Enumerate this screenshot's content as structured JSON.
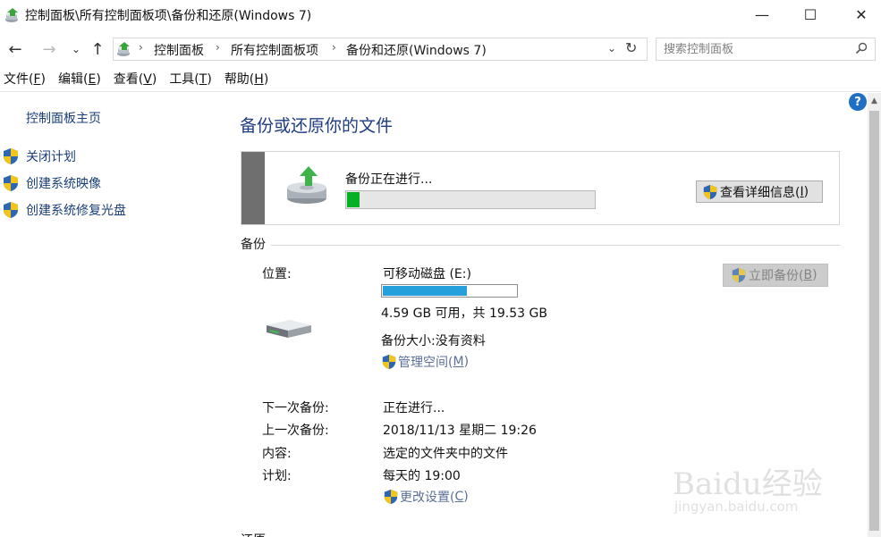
{
  "window": {
    "title": "控制面板\\所有控制面板项\\备份和还原(Windows 7)",
    "min_glyph": "—",
    "max_glyph": "☐",
    "close_glyph": "✕"
  },
  "nav": {
    "back_glyph": "←",
    "forward_glyph": "→",
    "recent_glyph": "⌄",
    "up_glyph": "↑",
    "breadcrumbs": [
      "控制面板",
      "所有控制面板项",
      "备份和还原(Windows 7)"
    ],
    "crumb_sep": "›",
    "dropdown_glyph": "⌄",
    "refresh_glyph": "↻",
    "search_placeholder": "搜索控制面板"
  },
  "menu": {
    "items": [
      {
        "label": "文件(",
        "key": "F",
        "end": ")"
      },
      {
        "label": "编辑(",
        "key": "E",
        "end": ")"
      },
      {
        "label": "查看(",
        "key": "V",
        "end": ")"
      },
      {
        "label": "工具(",
        "key": "T",
        "end": ")"
      },
      {
        "label": "帮助(",
        "key": "H",
        "end": ")"
      }
    ]
  },
  "sidebar": {
    "home": "控制面板主页",
    "tasks": [
      "关闭计划",
      "创建系统映像",
      "创建系统修复光盘"
    ]
  },
  "main": {
    "title": "备份或还原你的文件",
    "progress": {
      "status": "备份正在进行...",
      "fraction": 0.05,
      "details_label": "查看详细信息(",
      "details_key": "I",
      "details_end": ")"
    },
    "section_backup": "备份",
    "location_label": "位置:",
    "location_value": "可移动磁盘 (E:)",
    "disk_used_fraction": 0.62,
    "disk_space": "4.59 GB 可用，共 19.53 GB",
    "backup_size": "备份大小:没有资料",
    "manage_space": "管理空间(",
    "manage_space_key": "M",
    "manage_space_end": ")",
    "backup_now": "立即备份(",
    "backup_now_key": "B",
    "backup_now_end": ")",
    "next_backup_label": "下一次备份:",
    "next_backup_value": "正在进行...",
    "last_backup_label": "上一次备份:",
    "last_backup_value": "2018/11/13 星期二 19:26",
    "contents_label": "内容:",
    "contents_value": "选定的文件夹中的文件",
    "schedule_label": "计划:",
    "schedule_value": "每天的 19:00",
    "change_settings": "更改设置(",
    "change_settings_key": "C",
    "change_settings_end": ")",
    "cut_off_label": "还原"
  },
  "help_glyph": "?",
  "watermark": {
    "brand": "Baidu经验",
    "url": "jingyan.baidu.com"
  },
  "colors": {
    "link": "#1a3e78",
    "title": "#1e3d82",
    "progress_green": "#06b025",
    "disk_blue": "#26a0da",
    "shield_blue": "#2e67b1",
    "shield_yellow": "#f3c419"
  },
  "icons": [
    "control-panel-icon",
    "uac-shield-icon",
    "backup-drive-icon",
    "removable-disk-icon",
    "search-icon",
    "help-icon"
  ]
}
